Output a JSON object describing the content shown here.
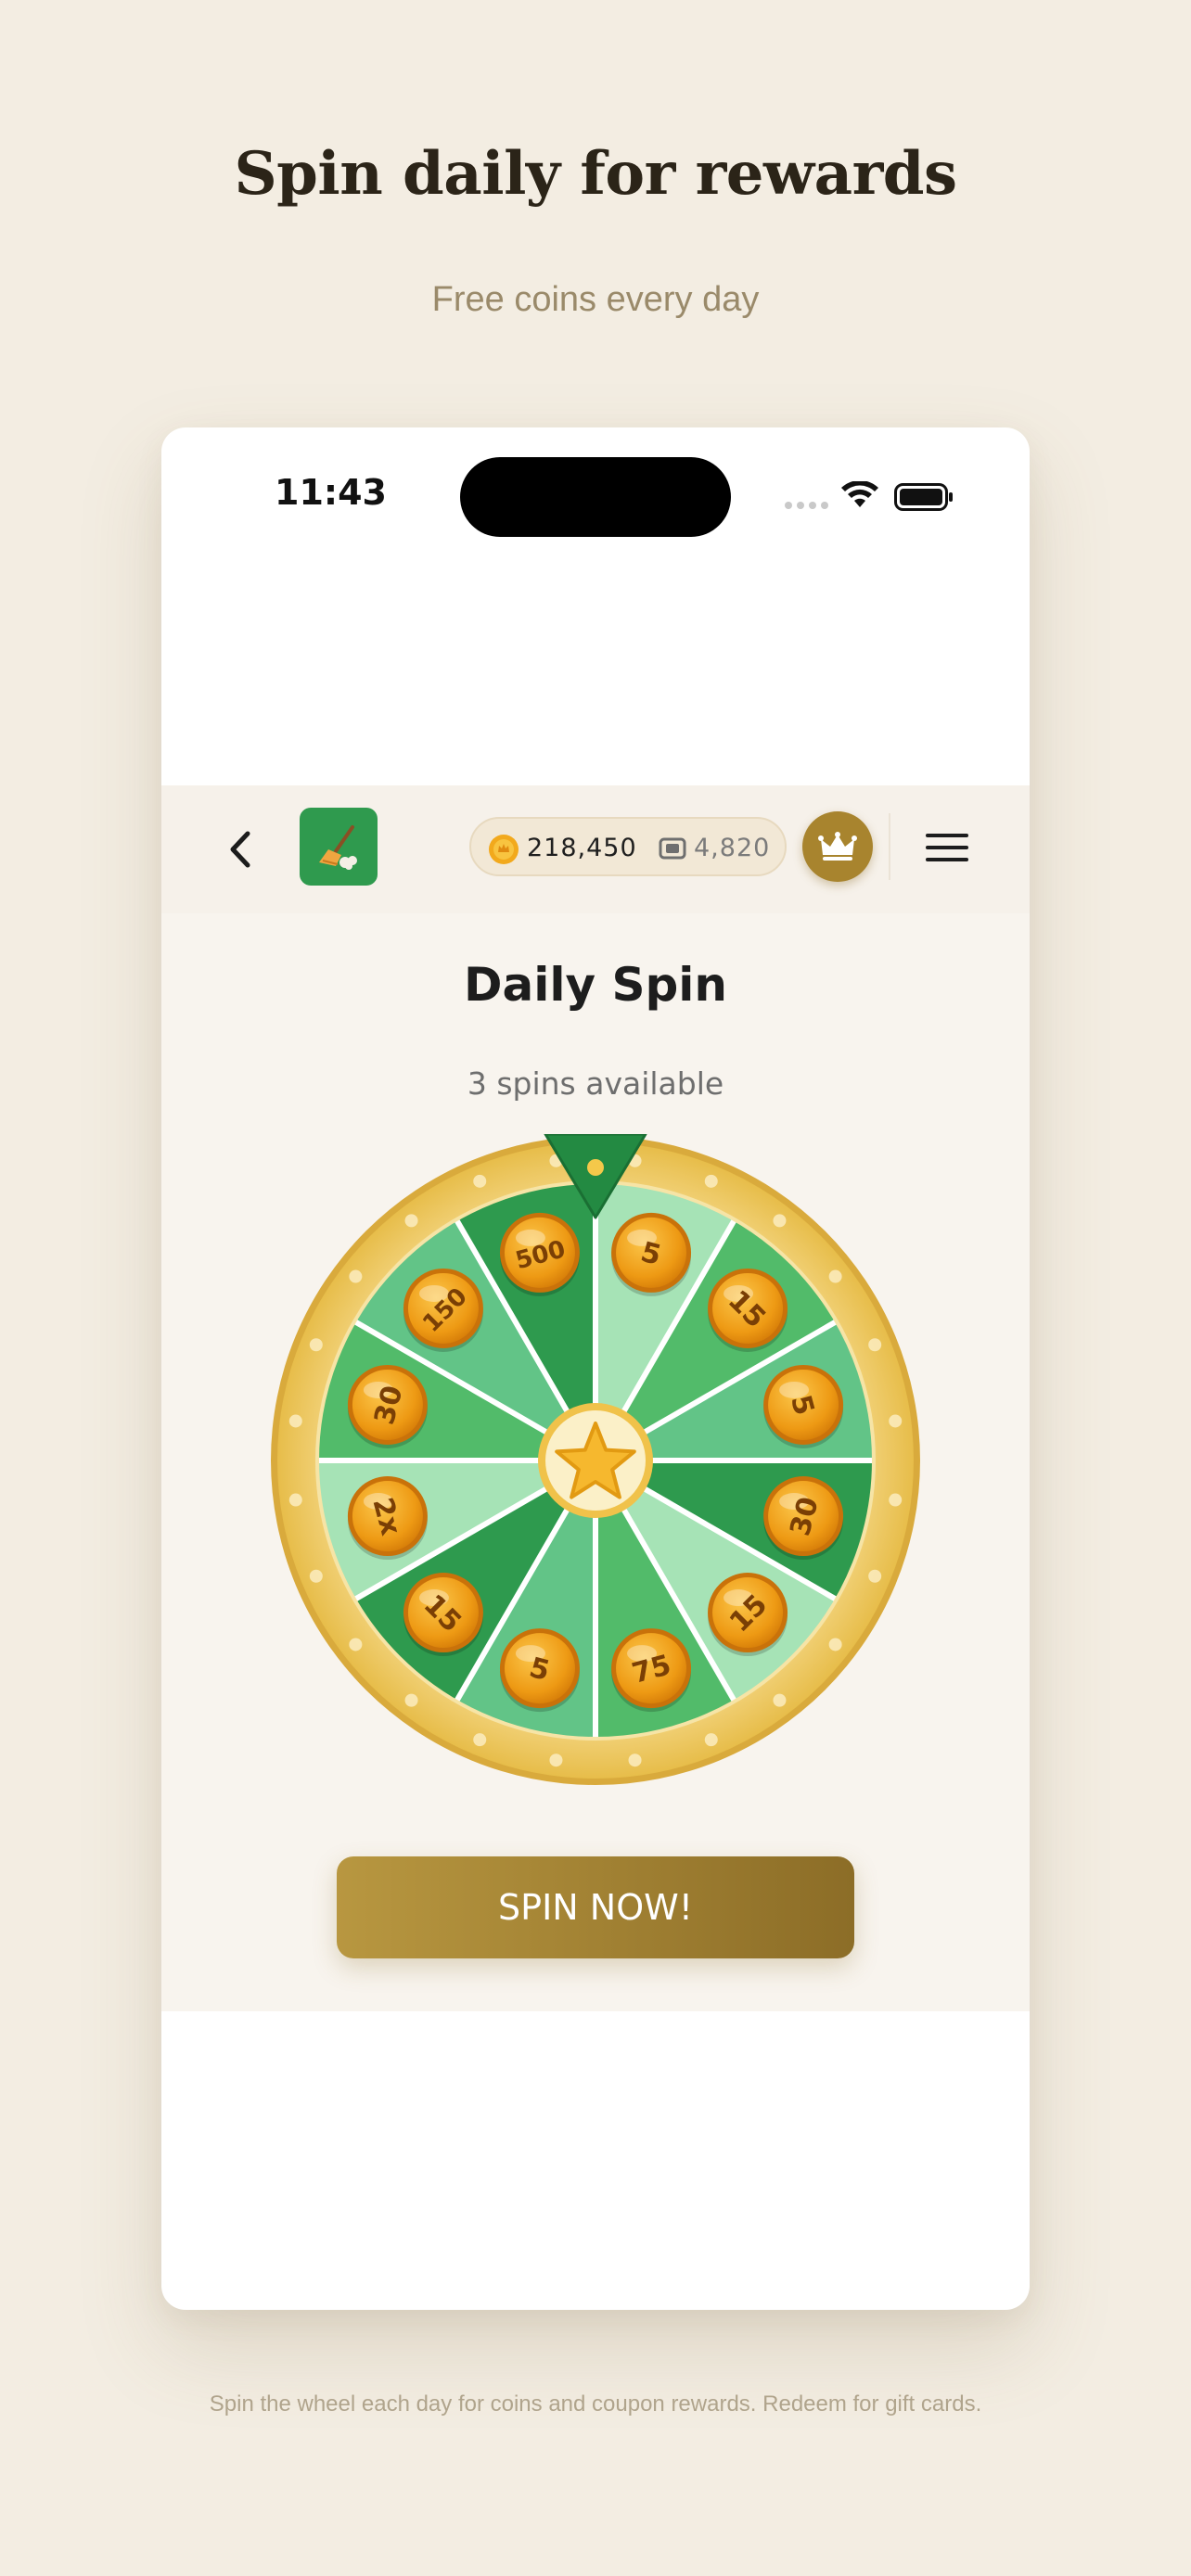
{
  "page": {
    "headline": "Spin daily for rewards",
    "subheadline": "Free coins every day",
    "footer": "Spin the wheel each day for coins and coupon rewards. Redeem for gift cards."
  },
  "status_bar": {
    "time": "11:43",
    "icons": [
      "signal-icon",
      "wifi-icon",
      "battery-icon"
    ]
  },
  "navbar": {
    "back_icon": "chevron-left-icon",
    "app_icon": "broom-app-icon",
    "coins": "218,450",
    "tickets": "4,820",
    "premium_icon": "crown-icon",
    "menu_icon": "hamburger-menu-icon"
  },
  "spin": {
    "title": "Daily Spin",
    "spins_available": "3 spins available",
    "button_label": "SPIN NOW!",
    "center_icon": "star-icon",
    "segments": [
      {
        "label": "5",
        "color": "#a6e3b6"
      },
      {
        "label": "15",
        "color": "#52bb6a"
      },
      {
        "label": "5",
        "color": "#62c487"
      },
      {
        "label": "30",
        "color": "#2e9a4e"
      },
      {
        "label": "15",
        "color": "#a6e3b6"
      },
      {
        "label": "75",
        "color": "#52bb6a"
      },
      {
        "label": "5",
        "color": "#62c487"
      },
      {
        "label": "15",
        "color": "#2e9a4e"
      },
      {
        "label": "2x",
        "color": "#a6e3b6"
      },
      {
        "label": "30",
        "color": "#52bb6a"
      },
      {
        "label": "150",
        "color": "#62c487"
      },
      {
        "label": "500",
        "color": "#2e9a4e"
      }
    ]
  },
  "colors": {
    "background": "#f3ede2",
    "accent_gold": "#a8842e",
    "wheel_rim": "#edc75c",
    "pointer": "#238a42",
    "coin": "#f0a21a"
  }
}
